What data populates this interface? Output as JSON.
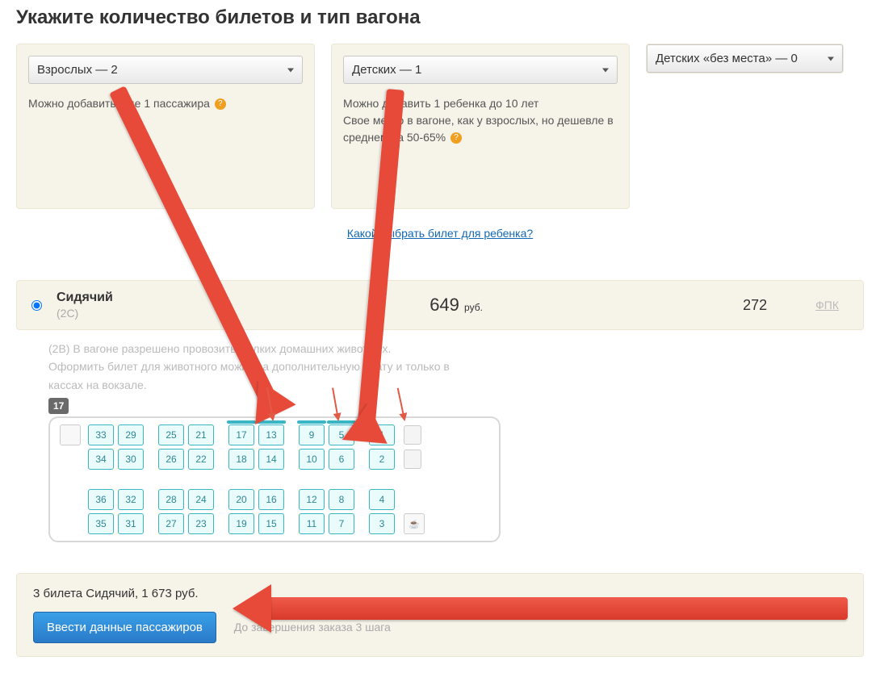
{
  "title": "Укажите количество билетов и тип вагона",
  "selects": {
    "adults": "Взрослых — 2",
    "children": "Детских — 1",
    "babies": "Детских «без места» — 0"
  },
  "hints": {
    "adults": "Можно добавить еще 1 пассажира",
    "children_line1": "Можно добавить 1 ребенка до 10 лет",
    "children_line2": "Свое место в вагоне, как у взрослых, но дешевле в среднем на 50-65%"
  },
  "help_icon": "?",
  "child_link": "Какой выбрать билет для ребенка?",
  "car": {
    "name": "Сидячий",
    "code": "(2С)",
    "price": "649",
    "price_unit": "руб.",
    "available": "272",
    "carrier": "ФПК"
  },
  "prev_note_1": "(2В) В вагоне разрешено провозить мелких домашних животных.",
  "prev_note_2": "Оформить билет для животного можно за дополнительную плату и только в кассах на вокзале.",
  "car_number": "17",
  "seats": {
    "row1": [
      "33",
      "29",
      "25",
      "21",
      "17",
      "13",
      "9",
      "5",
      "1"
    ],
    "row2": [
      "34",
      "30",
      "26",
      "22",
      "18",
      "14",
      "10",
      "6",
      "2"
    ],
    "row3": [
      "36",
      "32",
      "28",
      "24",
      "20",
      "16",
      "12",
      "8",
      "4"
    ],
    "row4": [
      "35",
      "31",
      "27",
      "23",
      "19",
      "15",
      "11",
      "7",
      "3"
    ]
  },
  "summary": "3 билета Сидячий, 1 673 руб.",
  "button": "Ввести данные пассажиров",
  "steps": "До завершения заказа 3 шага"
}
